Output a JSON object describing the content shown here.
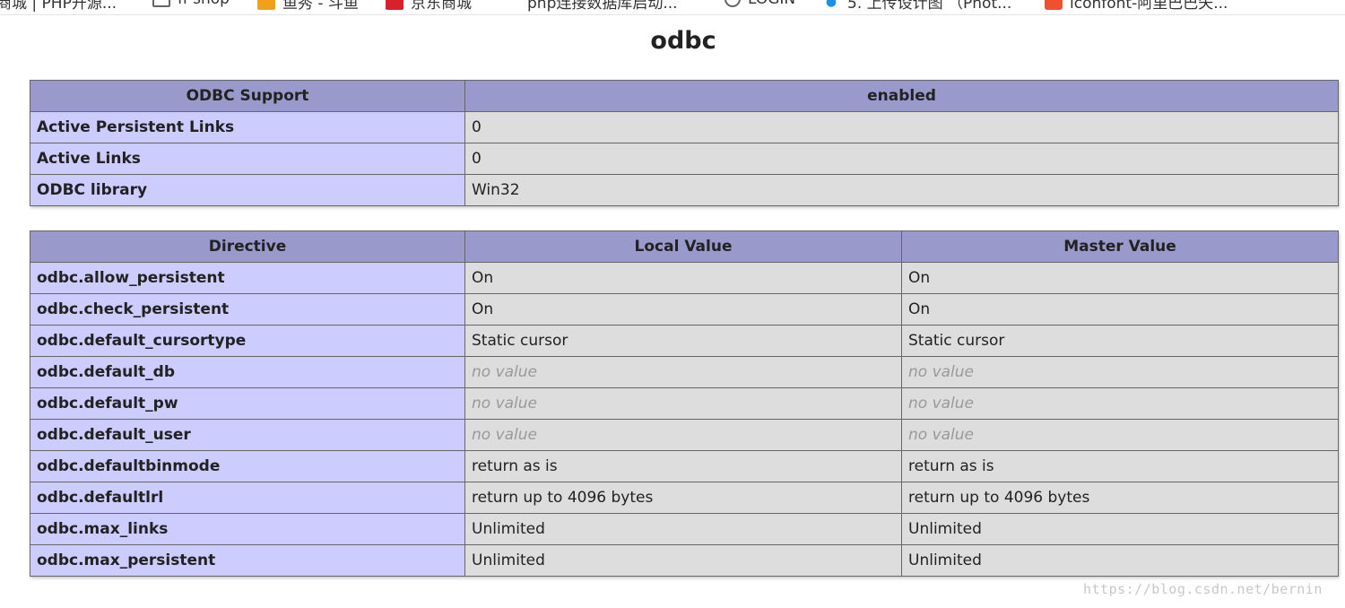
{
  "bookmarks": [
    {
      "label": "商城 | PHP开源...",
      "icon": "none"
    },
    {
      "label": "ff shop",
      "icon": "folder-icon"
    },
    {
      "label": "鱼秀 - 斗鱼",
      "icon": "douyu-icon"
    },
    {
      "label": "京东商城",
      "icon": "jd-icon"
    },
    {
      "label": "php连接数据库启动...",
      "icon": "baidu-icon"
    },
    {
      "label": "LOGIN",
      "icon": "globe-icon"
    },
    {
      "label": "5. 上传设计图 （Phot...",
      "icon": "qq-icon"
    },
    {
      "label": "iconfont-阿里巴巴矢...",
      "icon": "iconfont-icon"
    }
  ],
  "page": {
    "title": "odbc"
  },
  "support_table": {
    "headers": [
      "ODBC Support",
      "enabled"
    ],
    "rows": [
      {
        "name": "Active Persistent Links",
        "value": "0"
      },
      {
        "name": "Active Links",
        "value": "0"
      },
      {
        "name": "ODBC library",
        "value": "Win32"
      }
    ]
  },
  "directive_table": {
    "headers": [
      "Directive",
      "Local Value",
      "Master Value"
    ],
    "rows": [
      {
        "name": "odbc.allow_persistent",
        "local": "On",
        "master": "On",
        "no_value": false
      },
      {
        "name": "odbc.check_persistent",
        "local": "On",
        "master": "On",
        "no_value": false
      },
      {
        "name": "odbc.default_cursortype",
        "local": "Static cursor",
        "master": "Static cursor",
        "no_value": false
      },
      {
        "name": "odbc.default_db",
        "local": "no value",
        "master": "no value",
        "no_value": true
      },
      {
        "name": "odbc.default_pw",
        "local": "no value",
        "master": "no value",
        "no_value": true
      },
      {
        "name": "odbc.default_user",
        "local": "no value",
        "master": "no value",
        "no_value": true
      },
      {
        "name": "odbc.defaultbinmode",
        "local": "return as is",
        "master": "return as is",
        "no_value": false
      },
      {
        "name": "odbc.defaultlrl",
        "local": "return up to 4096 bytes",
        "master": "return up to 4096 bytes",
        "no_value": false
      },
      {
        "name": "odbc.max_links",
        "local": "Unlimited",
        "master": "Unlimited",
        "no_value": false
      },
      {
        "name": "odbc.max_persistent",
        "local": "Unlimited",
        "master": "Unlimited",
        "no_value": false
      }
    ]
  },
  "watermark": "https://blog.csdn.net/bernin",
  "colors": {
    "header_bg": "#9999cc",
    "name_bg": "#ccccff",
    "value_bg": "#dddddd",
    "no_value": "#999999"
  }
}
